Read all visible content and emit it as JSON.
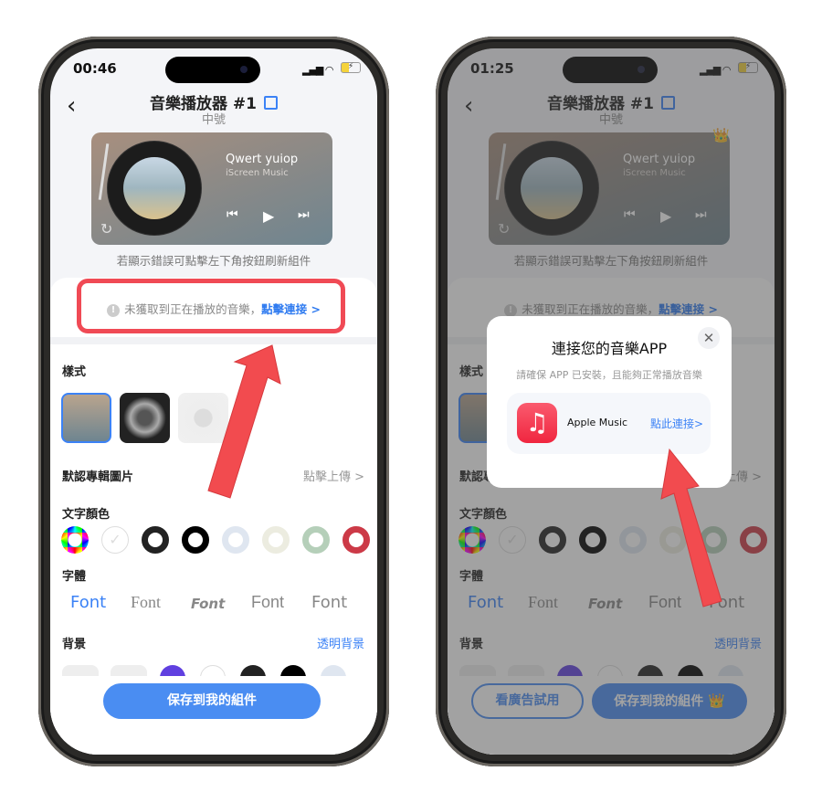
{
  "phones": [
    {
      "status": {
        "time": "00:46"
      },
      "header": {
        "title": "音樂播放器 #1",
        "subtitle": "中號"
      },
      "widget": {
        "song": "Qwert yuiop",
        "artist": "iScreen Music"
      },
      "hint": "若顯示錯誤可點擊左下角按鈕刷新組件",
      "alert": {
        "text": "未獲取到正在播放的音樂，",
        "link": "點擊連接 >"
      },
      "style_label": "樣式",
      "album_label": "默認專輯圖片",
      "album_action": "點擊上傳 >",
      "text_color_label": "文字顏色",
      "font_label": "字體",
      "fonts": [
        "Font",
        "Font",
        "Font",
        "Font",
        "Font"
      ],
      "background_label": "背景",
      "background_action": "透明背景",
      "save_label": "保存到我的組件"
    },
    {
      "status": {
        "time": "01:25"
      },
      "header": {
        "title": "音樂播放器 #1",
        "subtitle": "中號"
      },
      "widget": {
        "song": "Qwert yuiop",
        "artist": "iScreen Music"
      },
      "hint": "若顯示錯誤可點擊左下角按鈕刷新組件",
      "alert": {
        "text": "未獲取到正在播放的音樂，",
        "link": "點擊連接 >"
      },
      "style_label": "樣式",
      "album_label": "默認專輯圖片",
      "album_action": "點擊上傳 >",
      "text_color_label": "文字顏色",
      "font_label": "字體",
      "fonts": [
        "Font",
        "Font",
        "Font",
        "Font",
        "Font"
      ],
      "background_label": "背景",
      "background_action": "透明背景",
      "save_label": "保存到我的組件",
      "ad_label": "看廣告試用",
      "modal": {
        "title": "連接您的音樂APP",
        "subtitle": "請確保 APP 已安裝，且能夠正常播放音樂",
        "app_name": "Apple Music",
        "connect_label": "點此連接>"
      }
    }
  ],
  "colors": {
    "accent": "#3b82f6",
    "annotation": "#f04a55",
    "swatches": [
      "rainbow",
      "#ffffff",
      "#222222",
      "#000000",
      "#dfe6f0",
      "#ecece0",
      "#b5cfb9",
      "#cc3a47"
    ]
  }
}
